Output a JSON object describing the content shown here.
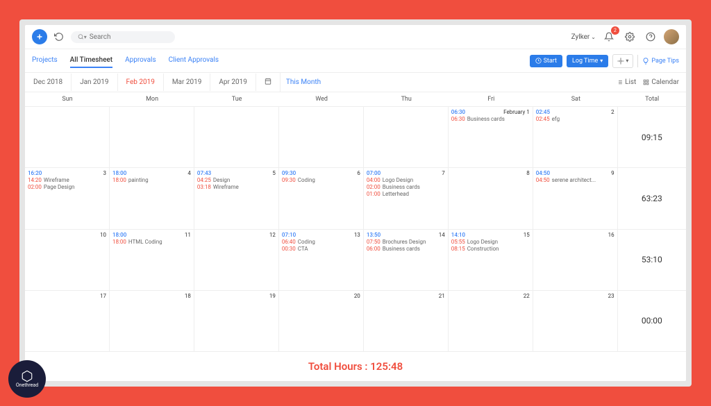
{
  "search": {
    "placeholder": "Search"
  },
  "company": "Zylker",
  "notifications": "2",
  "nav": {
    "tabs": [
      "Projects",
      "All Timesheet",
      "Approvals",
      "Client Approvals"
    ],
    "active": 1,
    "start": "Start",
    "logTime": "Log Time",
    "pageTips": "Page Tips"
  },
  "months": {
    "list": [
      "Dec 2018",
      "Jan 2019",
      "Feb 2019",
      "Mar 2019",
      "Apr 2019"
    ],
    "active": 2,
    "thisMonth": "This Month",
    "viewList": "List",
    "viewCalendar": "Calendar"
  },
  "days": [
    "Sun",
    "Mon",
    "Tue",
    "Wed",
    "Thu",
    "Fri",
    "Sat",
    "Total"
  ],
  "rows": [
    {
      "cells": [
        {},
        {},
        {},
        {},
        {},
        {
          "time": "06:30",
          "dateLabel": "February 1",
          "entries": [
            {
              "t": "06:30",
              "l": "Business cards"
            }
          ]
        },
        {
          "time": "02:45",
          "date": "2",
          "entries": [
            {
              "t": "02:45",
              "l": "efg"
            }
          ]
        }
      ],
      "total": "09:15"
    },
    {
      "cells": [
        {
          "time": "16:20",
          "date": "3",
          "entries": [
            {
              "t": "14:20",
              "l": "Wireframe"
            },
            {
              "t": "02:00",
              "l": "Page Design"
            }
          ]
        },
        {
          "time": "18:00",
          "date": "4",
          "entries": [
            {
              "t": "18:00",
              "l": "painting"
            }
          ]
        },
        {
          "time": "07:43",
          "date": "5",
          "entries": [
            {
              "t": "04:25",
              "l": "Design"
            },
            {
              "t": "03:18",
              "l": "Wireframe"
            }
          ]
        },
        {
          "time": "09:30",
          "date": "6",
          "entries": [
            {
              "t": "09:30",
              "l": "Coding"
            }
          ]
        },
        {
          "time": "07:00",
          "date": "7",
          "entries": [
            {
              "t": "04:00",
              "l": "Logo Design"
            },
            {
              "t": "02:00",
              "l": "Business cards"
            },
            {
              "t": "01:00",
              "l": "Letterhead"
            }
          ]
        },
        {
          "date": "8"
        },
        {
          "time": "04:50",
          "date": "9",
          "entries": [
            {
              "t": "04:50",
              "l": "serene architect..."
            }
          ]
        }
      ],
      "total": "63:23"
    },
    {
      "cells": [
        {
          "date": "10"
        },
        {
          "time": "18:00",
          "date": "11",
          "entries": [
            {
              "t": "18:00",
              "l": "HTML Coding"
            }
          ]
        },
        {
          "date": "12"
        },
        {
          "time": "07:10",
          "date": "13",
          "entries": [
            {
              "t": "06:40",
              "l": "Coding"
            },
            {
              "t": "00:30",
              "l": "CTA"
            }
          ]
        },
        {
          "time": "13:50",
          "date": "14",
          "entries": [
            {
              "t": "07:50",
              "l": "Brochures Design"
            },
            {
              "t": "06:00",
              "l": "Business cards"
            }
          ]
        },
        {
          "time": "14:10",
          "date": "15",
          "entries": [
            {
              "t": "05:55",
              "l": "Logo Design"
            },
            {
              "t": "08:15",
              "l": "Construction"
            }
          ]
        },
        {
          "date": "16"
        }
      ],
      "total": "53:10"
    },
    {
      "cells": [
        {
          "date": "17"
        },
        {
          "date": "18"
        },
        {
          "date": "19"
        },
        {
          "date": "20"
        },
        {
          "date": "21"
        },
        {
          "date": "22"
        },
        {
          "date": "23"
        }
      ],
      "total": "00:00"
    }
  ],
  "footer": {
    "label": "Total Hours : ",
    "value": "125:48"
  },
  "brand": "Onethread"
}
